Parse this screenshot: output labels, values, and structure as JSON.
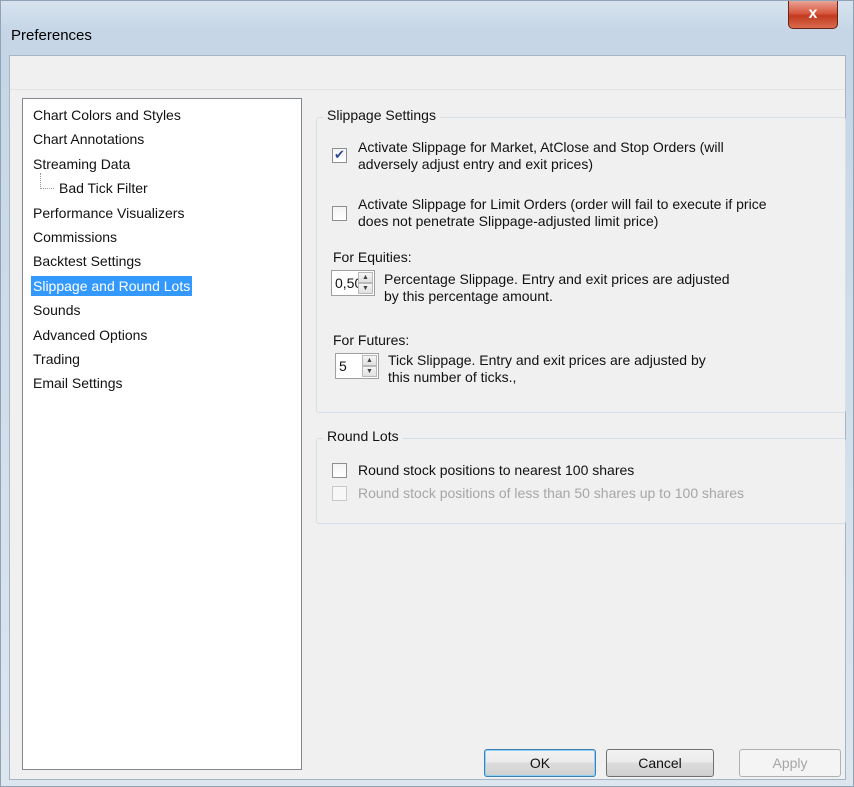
{
  "window": {
    "title": "Preferences",
    "close_label": "x"
  },
  "sidebar": {
    "items": [
      {
        "label": "Chart Colors and Styles",
        "selected": false
      },
      {
        "label": "Chart Annotations",
        "selected": false
      },
      {
        "label": "Streaming Data",
        "selected": false
      },
      {
        "label": "Bad Tick Filter",
        "selected": false,
        "child": true
      },
      {
        "label": "Performance Visualizers",
        "selected": false
      },
      {
        "label": "Commissions",
        "selected": false
      },
      {
        "label": "Backtest Settings",
        "selected": false
      },
      {
        "label": "Slippage and Round Lots",
        "selected": true
      },
      {
        "label": "Sounds",
        "selected": false
      },
      {
        "label": "Advanced Options",
        "selected": false
      },
      {
        "label": "Trading",
        "selected": false
      },
      {
        "label": "Email Settings",
        "selected": false
      }
    ]
  },
  "slippage": {
    "title": "Slippage Settings",
    "market_checkbox": {
      "checked": true,
      "line1": "Activate Slippage for Market, AtClose and Stop Orders (will",
      "line2": "adversely adjust entry and exit prices)"
    },
    "limit_checkbox": {
      "checked": false,
      "line1": "Activate Slippage for Limit Orders (order will fail to execute if price",
      "line2": "does not penetrate Slippage-adjusted limit price)"
    },
    "equities": {
      "label": "For Equities:",
      "value": "0,50",
      "line1": "Percentage Slippage.  Entry and exit prices are adjusted",
      "line2": "by this percentage amount."
    },
    "futures": {
      "label": "For Futures:",
      "value": "5",
      "line1": "Tick Slippage.  Entry and exit prices are adjusted by",
      "line2": "this number of ticks.,"
    }
  },
  "round_lots": {
    "title": "Round Lots",
    "nearest_100": {
      "checked": false,
      "label": "Round stock positions to nearest 100 shares",
      "enabled": true
    },
    "less_than_50": {
      "checked": false,
      "label": "Round stock positions of less than 50 shares up to 100 shares",
      "enabled": false
    }
  },
  "buttons": {
    "ok": "OK",
    "cancel": "Cancel",
    "apply": "Apply"
  }
}
